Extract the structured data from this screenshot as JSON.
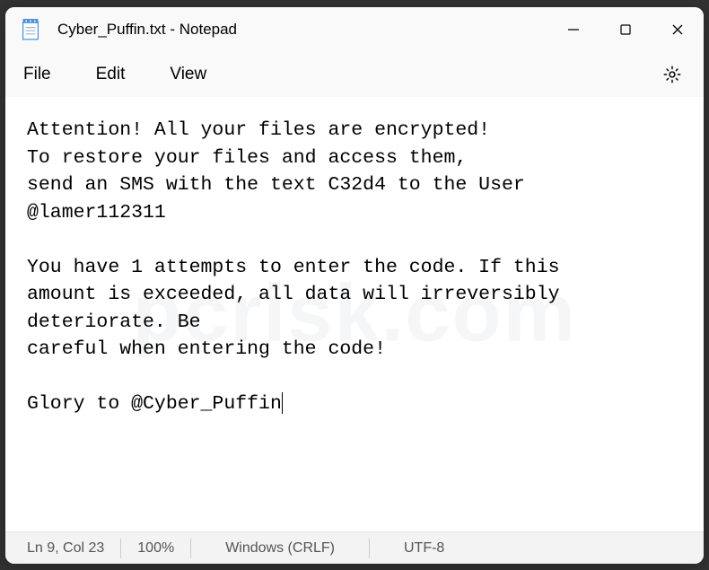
{
  "window": {
    "title": "Cyber_Puffin.txt - Notepad"
  },
  "menu": {
    "file": "File",
    "edit": "Edit",
    "view": "View"
  },
  "content": {
    "text": "Attention! All your files are encrypted!\nTo restore your files and access them,\nsend an SMS with the text C32d4 to the User\n@lamer112311\n\nYou have 1 attempts to enter the code. If this\namount is exceeded, all data will irreversibly\ndeteriorate. Be\ncareful when entering the code!\n\nGlory to @Cyber_Puffin"
  },
  "status": {
    "position": "Ln 9, Col 23",
    "zoom": "100%",
    "line_ending": "Windows (CRLF)",
    "encoding": "UTF-8"
  },
  "watermark": "pcrisk.com"
}
